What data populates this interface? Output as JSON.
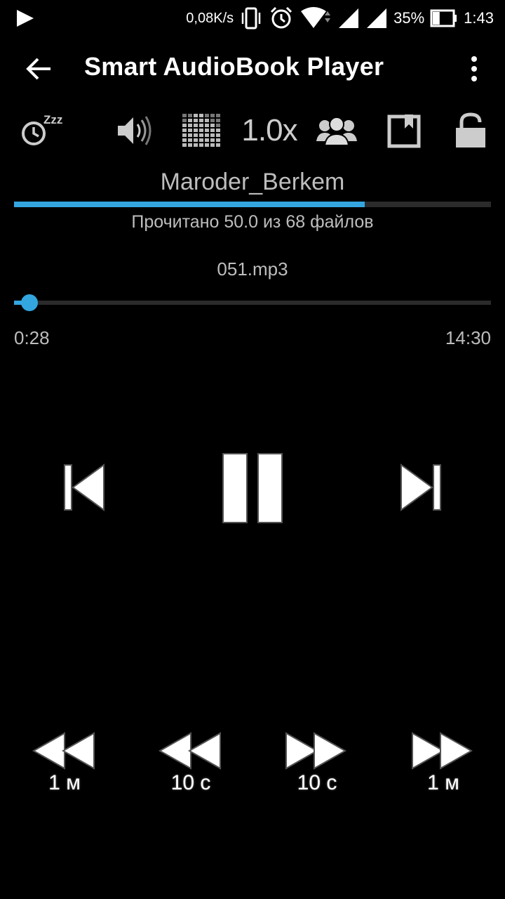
{
  "status_bar": {
    "net_speed": "0,08K/s",
    "battery_percent": "35%",
    "battery_level": 0.35,
    "time": "1:43",
    "icons": [
      "play-notification-icon",
      "vibrate-icon",
      "alarm-icon",
      "wifi-icon",
      "signal-icon",
      "signal-icon",
      "battery-icon"
    ]
  },
  "app_bar": {
    "title": "Smart AudioBook Player",
    "back_icon": "arrow-back-icon",
    "menu_icon": "more-vert-icon"
  },
  "toolbar": {
    "sleep_icon": "sleep-timer-icon",
    "sleep_label": "Zzz",
    "volume_icon": "volume-icon",
    "equalizer_icon": "equalizer-icon",
    "speed_label": "1.0x",
    "characters_icon": "characters-icon",
    "bookmark_icon": "bookmark-icon",
    "lock_icon": "lock-icon"
  },
  "book": {
    "title": "Maroder_Berkem",
    "progress_text": "Прочитано 50.0 из 68 файлов",
    "progress_fraction": 0.735
  },
  "track": {
    "file_name": "051.mp3",
    "current_time": "0:28",
    "total_time": "14:30",
    "position_fraction": 0.032
  },
  "controls": {
    "previous_icon": "skip-previous-icon",
    "pause_icon": "pause-icon",
    "next_icon": "skip-next-icon"
  },
  "skip_buttons": [
    {
      "label": "1 м",
      "icon": "rewind-icon"
    },
    {
      "label": "10 с",
      "icon": "rewind-icon"
    },
    {
      "label": "10 с",
      "icon": "fast-forward-icon"
    },
    {
      "label": "1 м",
      "icon": "fast-forward-icon"
    }
  ],
  "colors": {
    "accent": "#33a6e0",
    "background": "#000000",
    "secondary_text": "#bdbdbd"
  }
}
